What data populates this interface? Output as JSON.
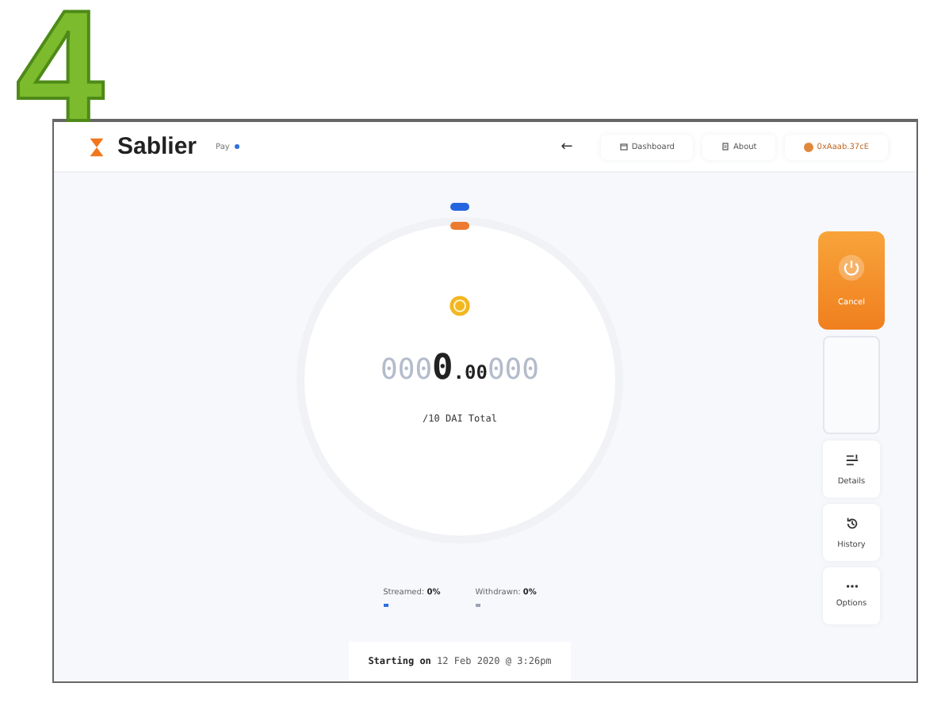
{
  "step_number": "4",
  "header": {
    "brand": "Sablier",
    "badge": "Pay",
    "back": "←",
    "nav": [
      {
        "label": "Dashboard"
      },
      {
        "label": "About"
      }
    ],
    "account": "0xAaab.37cE"
  },
  "stream": {
    "amount": {
      "lead": "000",
      "main": "0",
      "decimals": ".00",
      "trail": "000"
    },
    "total": "/10 DAI Total"
  },
  "stats": [
    {
      "label": "Streamed:",
      "value": "0%",
      "color": "#2f6fe0"
    },
    {
      "label": "Withdrawn:",
      "value": "0%",
      "color": "#9aa3b5"
    }
  ],
  "start": {
    "prefix": "Starting on",
    "date": "12 Feb 2020 @ 3:26pm"
  },
  "actions": [
    {
      "kind": "primary",
      "label": "Cancel"
    },
    {
      "kind": "spacer"
    },
    {
      "kind": "card",
      "label": "Details"
    },
    {
      "kind": "card",
      "label": "History"
    },
    {
      "kind": "card",
      "label": "Options"
    }
  ]
}
